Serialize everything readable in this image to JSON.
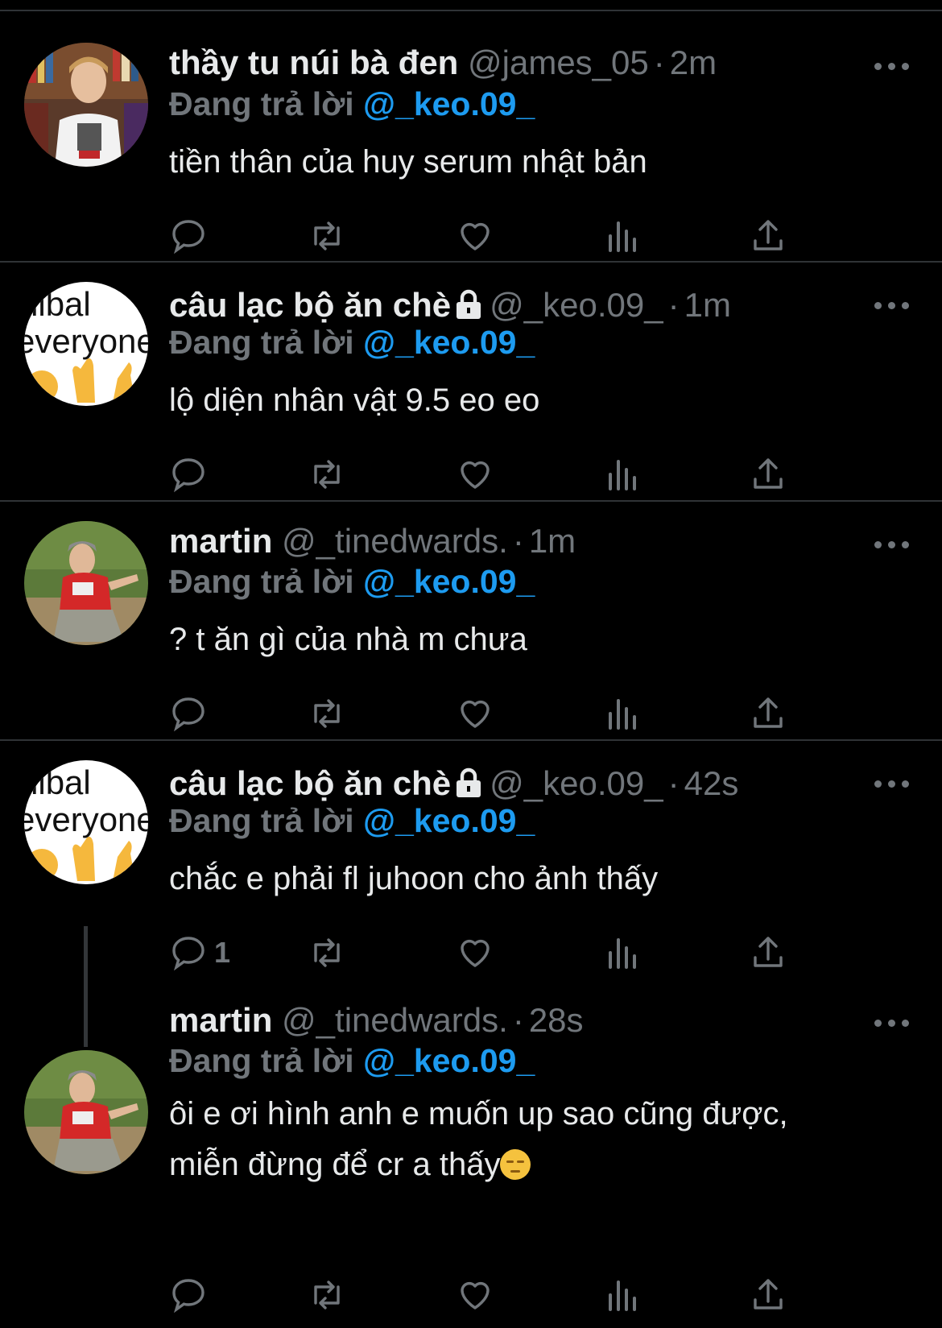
{
  "tweets": [
    {
      "display_name": "thầy tu núi bà đen",
      "handle": "@james_05",
      "separator": "·",
      "time": "2m",
      "locked": false,
      "replying_prefix": "Đang trả lời",
      "replying_to": "@_keo.09_",
      "text": "tiền thân của huy serum nhật bản",
      "reply_count": ""
    },
    {
      "display_name": "câu lạc bộ ăn chè",
      "handle": "@_keo.09_",
      "separator": "·",
      "time": "1m",
      "locked": true,
      "replying_prefix": "Đang trả lời",
      "replying_to": "@_keo.09_",
      "text": "lộ diện nhân vật 9.5 eo eo",
      "reply_count": ""
    },
    {
      "display_name": "martin",
      "handle": "@_tinedwards.",
      "separator": "·",
      "time": "1m",
      "locked": false,
      "replying_prefix": "Đang trả lời",
      "replying_to": "@_keo.09_",
      "text": "? t ăn gì của nhà m chưa",
      "reply_count": ""
    },
    {
      "display_name": "câu lạc bộ ăn chè",
      "handle": "@_keo.09_",
      "separator": "·",
      "time": "42s",
      "locked": true,
      "replying_prefix": "Đang trả lời",
      "replying_to": "@_keo.09_",
      "text": "chắc e phải fl juhoon cho ảnh thấy",
      "reply_count": "1"
    },
    {
      "display_name": "martin",
      "handle": "@_tinedwards.",
      "separator": "·",
      "time": "28s",
      "locked": false,
      "replying_prefix": "Đang trả lời",
      "replying_to": "@_keo.09_",
      "text_line1": "ôi e ơi hình anh e muốn up sao cũng được,",
      "text_line2": "miễn đừng để cr a thấy",
      "reply_count": ""
    }
  ],
  "avatar_text": {
    "line1": "nibal",
    "line2": "everyone"
  },
  "icons": [
    "reply-icon",
    "retweet-icon",
    "like-icon",
    "views-icon",
    "share-icon",
    "more-icon",
    "lock-icon",
    "pensive-emoji"
  ]
}
